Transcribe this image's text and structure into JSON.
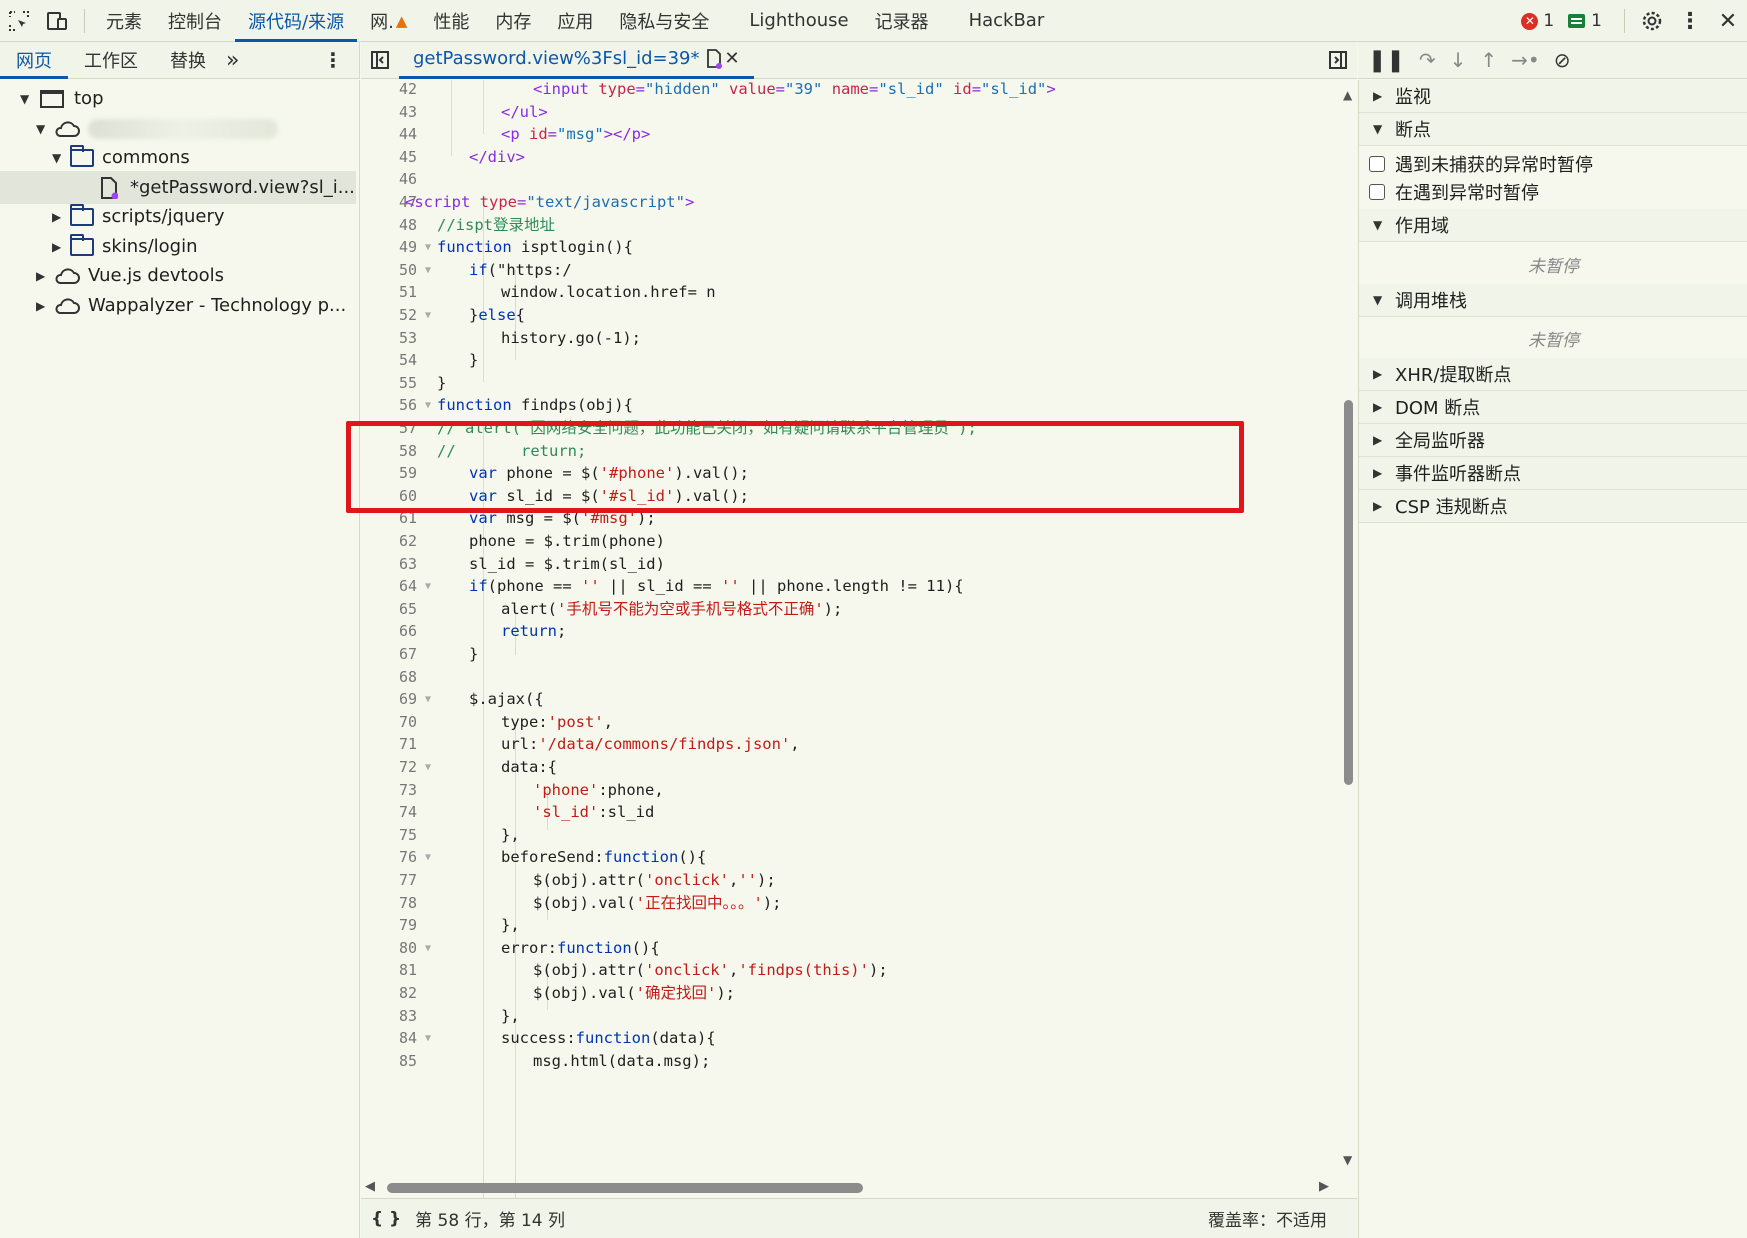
{
  "toolbar": {
    "tabs": [
      "元素",
      "控制台",
      "源代码/来源",
      "网.",
      "性能",
      "内存",
      "应用",
      "隐私与安全",
      "Lighthouse",
      "记录器",
      "HackBar"
    ],
    "active": "源代码/来源",
    "errors": "1",
    "messages": "1"
  },
  "navigator": {
    "tabs": [
      "网页",
      "工作区",
      "替换"
    ],
    "more": "»",
    "tree": {
      "top": "top",
      "domain": "",
      "commons": "commons",
      "file": "*getPassword.view?sl_i...",
      "jquery": "scripts/jquery",
      "skins": "skins/login",
      "vue": "Vue.js devtools",
      "wappalyzer": "Wappalyzer - Technology p..."
    }
  },
  "editor": {
    "tab_title": "getPassword.view%3Fsl_id=39*",
    "lines": [
      {
        "n": "42",
        "i": 4,
        "h": "&lt;input type=\"hidden\" value=\"39\" name=\"sl_id\" id=\"sl_id\"&gt;",
        "type": "html"
      },
      {
        "n": "43",
        "i": 3
      },
      {
        "n": "44",
        "i": 3
      },
      {
        "n": "45",
        "i": 2
      },
      {
        "n": "46",
        "i": 0
      },
      {
        "n": "47",
        "i": 0
      },
      {
        "n": "48",
        "i": 1
      },
      {
        "n": "49",
        "i": 1
      },
      {
        "n": "50",
        "i": 2
      },
      {
        "n": "51",
        "i": 3
      },
      {
        "n": "52",
        "i": 2
      },
      {
        "n": "53",
        "i": 3
      },
      {
        "n": "54",
        "i": 2
      },
      {
        "n": "55",
        "i": 1
      },
      {
        "n": "56",
        "i": 1
      },
      {
        "n": "57",
        "i": 1
      },
      {
        "n": "58",
        "i": 1
      },
      {
        "n": "59",
        "i": 2
      },
      {
        "n": "60",
        "i": 2
      },
      {
        "n": "61",
        "i": 2
      },
      {
        "n": "62",
        "i": 2
      },
      {
        "n": "63",
        "i": 2
      },
      {
        "n": "64",
        "i": 2
      },
      {
        "n": "65",
        "i": 3
      },
      {
        "n": "66",
        "i": 3
      },
      {
        "n": "67",
        "i": 2
      },
      {
        "n": "68",
        "i": 0
      },
      {
        "n": "69",
        "i": 2
      },
      {
        "n": "70",
        "i": 3
      },
      {
        "n": "71",
        "i": 3
      },
      {
        "n": "72",
        "i": 3
      },
      {
        "n": "73",
        "i": 4
      },
      {
        "n": "74",
        "i": 4
      },
      {
        "n": "75",
        "i": 3
      },
      {
        "n": "76",
        "i": 3
      },
      {
        "n": "77",
        "i": 4
      },
      {
        "n": "78",
        "i": 4
      },
      {
        "n": "79",
        "i": 3
      },
      {
        "n": "80",
        "i": 3
      },
      {
        "n": "81",
        "i": 4
      },
      {
        "n": "82",
        "i": 4
      },
      {
        "n": "83",
        "i": 3
      },
      {
        "n": "84",
        "i": 3
      },
      {
        "n": "85",
        "i": 4
      }
    ],
    "text": {
      "43": "</ul>",
      "44": "<p id=\"msg\"></p>",
      "45": "</div>",
      "47": "<script type=\"text/javascript\">",
      "48": "//ispt登录地址",
      "49": "function isptlogin(){",
      "50": "if(\"https:/",
      "51": "window.location.href= n",
      "52": "}else{",
      "53": "history.go(-1);",
      "54": "}",
      "55": "}",
      "56": "function findps(obj){",
      "57": "// alert(\"因网络安全问题，此功能已关闭，如有疑问请联系平台管理员\");",
      "58": "//       return;",
      "59": "var phone = $('#phone').val();",
      "60": "var sl_id = $('#sl_id').val();",
      "61": "var msg = $('#msg');",
      "62": "phone = $.trim(phone)",
      "63": "sl_id = $.trim(sl_id)",
      "64": "if(phone == '' || sl_id == '' || phone.length != 11){",
      "65": "alert('手机号不能为空或手机号格式不正确');",
      "66": "return;",
      "67": "}",
      "69": "$.ajax({",
      "70": "type:'post',",
      "71": "url:'/data/commons/findps.json',",
      "72": "data:{",
      "73": "'phone':phone,",
      "74": "'sl_id':sl_id",
      "75": "},",
      "76": "beforeSend:function(){",
      "77": "$(obj).attr('onclick','');",
      "78": "$(obj).val('正在找回中。。。');",
      "79": "},",
      "80": "error:function(){",
      "81": "$(obj).attr('onclick','findps(this)');",
      "82": "$(obj).val('确定找回');",
      "83": "},",
      "84": "success:function(data){",
      "85": "msg.html(data.msg);"
    }
  },
  "status": {
    "position": "第 58 行，第 14 列",
    "coverage": "覆盖率：不适用"
  },
  "debugger": {
    "watch": "监视",
    "breakpoints": "断点",
    "chk1": "遇到未捕获的异常时暂停",
    "chk2": "在遇到异常时暂停",
    "scope": "作用域",
    "not_paused": "未暂停",
    "callstack": "调用堆栈",
    "xhr": "XHR/提取断点",
    "dom": "DOM 断点",
    "global": "全局监听器",
    "event": "事件监听器断点",
    "csp": "CSP 违规断点"
  }
}
